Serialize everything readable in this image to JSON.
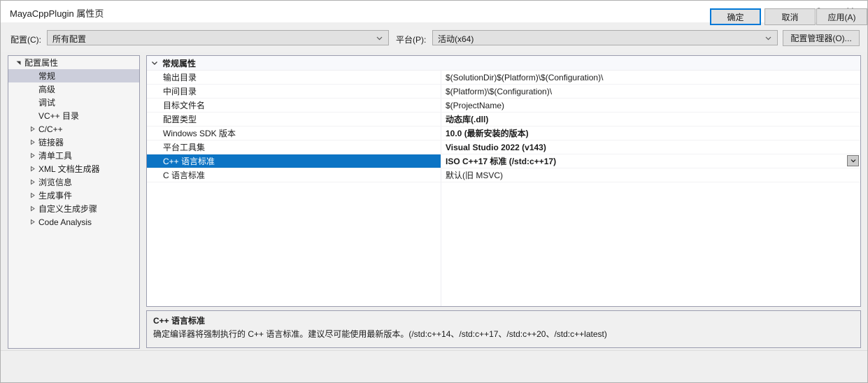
{
  "window": {
    "title": "MayaCppPlugin 属性页",
    "help_icon": "?",
    "close_icon": "✕"
  },
  "configbar": {
    "config_label": "配置(C):",
    "config_value": "所有配置",
    "platform_label": "平台(P):",
    "platform_value": "活动(x64)",
    "config_manager_button": "配置管理器(O)..."
  },
  "tree": {
    "items": [
      {
        "label": "配置属性",
        "indent": 0,
        "arrow": "expanded",
        "selected": false
      },
      {
        "label": "常规",
        "indent": 1,
        "arrow": "none",
        "selected": true
      },
      {
        "label": "高级",
        "indent": 1,
        "arrow": "none",
        "selected": false
      },
      {
        "label": "调试",
        "indent": 1,
        "arrow": "none",
        "selected": false
      },
      {
        "label": "VC++ 目录",
        "indent": 1,
        "arrow": "none",
        "selected": false
      },
      {
        "label": "C/C++",
        "indent": 1,
        "arrow": "collapsed",
        "selected": false
      },
      {
        "label": "链接器",
        "indent": 1,
        "arrow": "collapsed",
        "selected": false
      },
      {
        "label": "清单工具",
        "indent": 1,
        "arrow": "collapsed",
        "selected": false
      },
      {
        "label": "XML 文档生成器",
        "indent": 1,
        "arrow": "collapsed",
        "selected": false
      },
      {
        "label": "浏览信息",
        "indent": 1,
        "arrow": "collapsed",
        "selected": false
      },
      {
        "label": "生成事件",
        "indent": 1,
        "arrow": "collapsed",
        "selected": false
      },
      {
        "label": "自定义生成步骤",
        "indent": 1,
        "arrow": "collapsed",
        "selected": false
      },
      {
        "label": "Code Analysis",
        "indent": 1,
        "arrow": "collapsed",
        "selected": false
      }
    ]
  },
  "grid": {
    "group_label": "常规属性",
    "rows": [
      {
        "name": "输出目录",
        "value": "$(SolutionDir)$(Platform)\\$(Configuration)\\",
        "bold": false,
        "selected": false
      },
      {
        "name": "中间目录",
        "value": "$(Platform)\\$(Configuration)\\",
        "bold": false,
        "selected": false
      },
      {
        "name": "目标文件名",
        "value": "$(ProjectName)",
        "bold": false,
        "selected": false
      },
      {
        "name": "配置类型",
        "value": "动态库(.dll)",
        "bold": true,
        "selected": false
      },
      {
        "name": "Windows SDK 版本",
        "value": "10.0 (最新安装的版本)",
        "bold": true,
        "selected": false
      },
      {
        "name": "平台工具集",
        "value": "Visual Studio 2022 (v143)",
        "bold": true,
        "selected": false
      },
      {
        "name": "C++ 语言标准",
        "value": "ISO C++17 标准 (/std:c++17)",
        "bold": true,
        "selected": true
      },
      {
        "name": "C 语言标准",
        "value": "默认(旧 MSVC)",
        "bold": false,
        "selected": false
      }
    ]
  },
  "description": {
    "title": "C++ 语言标准",
    "body": "确定编译器将强制执行的 C++ 语言标准。建议尽可能使用最新版本。(/std:c++14、/std:c++17、/std:c++20、/std:c++latest)"
  },
  "footer": {
    "ok": "确定",
    "cancel": "取消",
    "apply": "应用(A)"
  },
  "colors": {
    "selection_blue": "#0c74c4",
    "tree_selection": "#cccedb",
    "accent_focus": "#0078d7"
  }
}
